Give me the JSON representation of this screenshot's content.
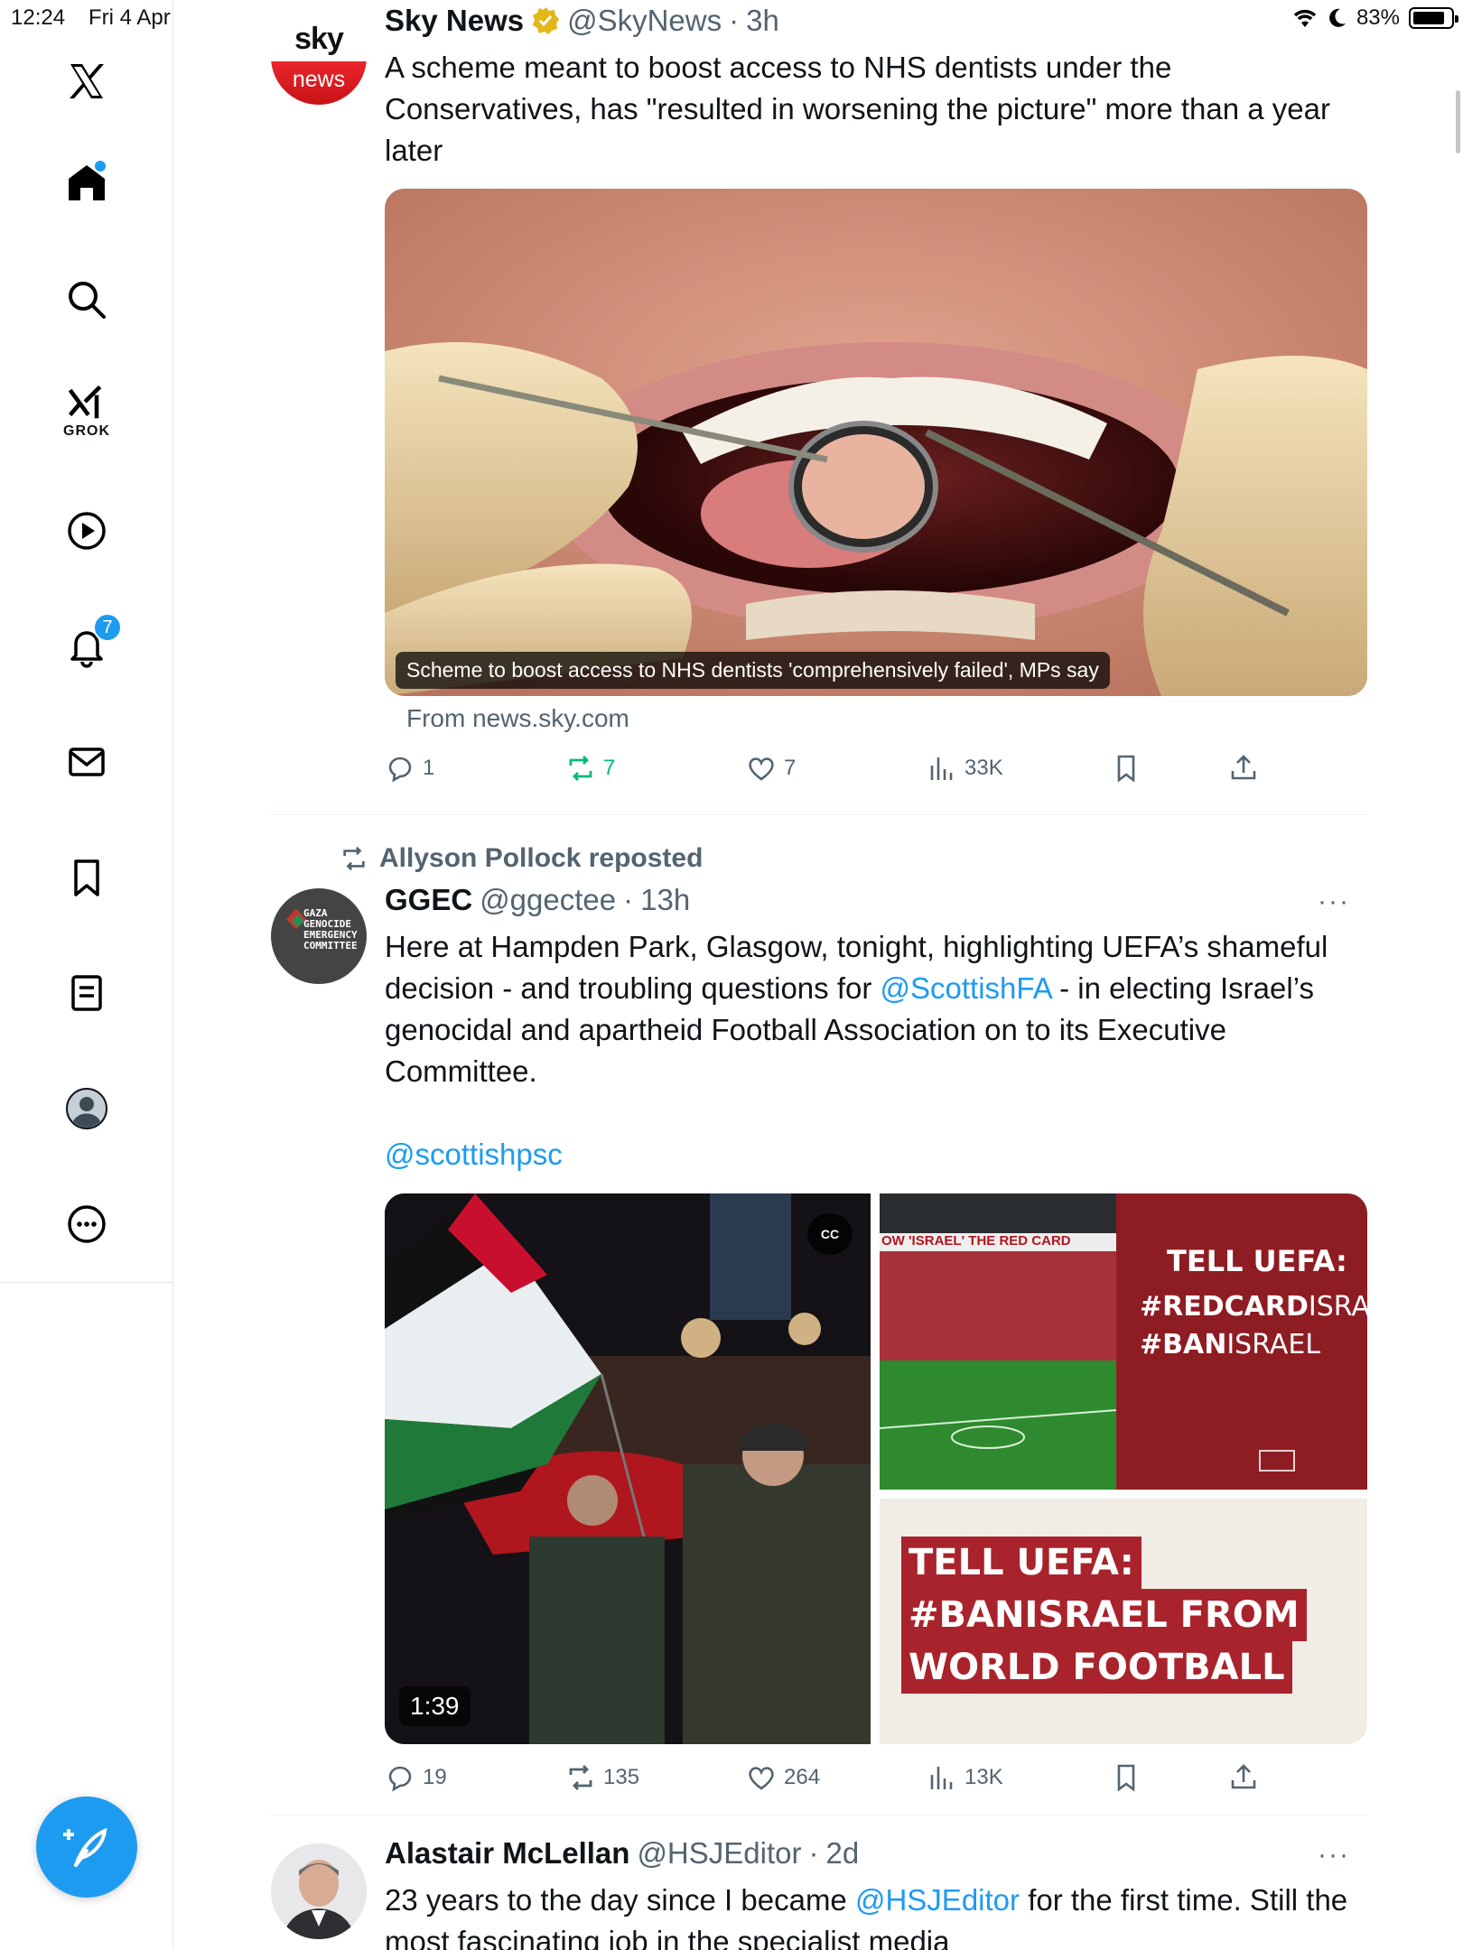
{
  "status": {
    "time": "12:24",
    "date": "Fri 4 Apr",
    "battery": "83%"
  },
  "sidebar": {
    "grok_label": "GROK",
    "notification_count": "7"
  },
  "tweets": [
    {
      "name": "Sky News",
      "handle": "@SkyNews",
      "time": "3h",
      "avatar_text_top": "sky",
      "avatar_text_bottom": "news",
      "text": "A scheme meant to boost access to NHS dentists under the Conservatives, has \"resulted in worsening the picture\" more than a year later",
      "card_caption": "Scheme to boost access to NHS dentists 'comprehensively failed', MPs say",
      "card_source": "From news.sky.com",
      "replies": "1",
      "reposts": "7",
      "likes": "7",
      "views": "33K"
    },
    {
      "repost_by": "Allyson Pollock reposted",
      "name": "GGEC",
      "handle": "@ggectee",
      "time": "13h",
      "avatar_lines": [
        "GAZA",
        "GENOCIDE",
        "EMERGENCY",
        "COMMITTEE"
      ],
      "text_1": "Here at Hampden Park, Glasgow, tonight, highlighting UEFA’s shameful decision - and troubling questions for ",
      "mention_1": "@ScottishFA",
      "text_2": " - in electing Israel’s genocidal and apartheid Football Association on to its Executive Committee.",
      "mention_2": "@scottishpsc",
      "video_duration": "1:39",
      "cc_label": "CC",
      "banner_text": "OW 'ISRAEL' THE RED CARD",
      "panel_title": "TELL UEFA:",
      "panel_tag1_bold": "#REDCARD",
      "panel_tag1_rest": "ISRAEL",
      "panel_tag2_bold": "#BAN",
      "panel_tag2_rest": "ISRAEL",
      "bottom_line1": "TELL UEFA:",
      "bottom_line2": "#BANISRAEL FROM",
      "bottom_line3": "WORLD FOOTBALL",
      "replies": "19",
      "reposts": "135",
      "likes": "264",
      "views": "13K"
    },
    {
      "name": "Alastair McLellan",
      "handle": "@HSJEditor",
      "time": "2d",
      "text_1": "23 years to the day since I became ",
      "mention": "@HSJEditor",
      "text_2": " for the first time. Still the most fascinating job in the specialist media"
    }
  ],
  "colors": {
    "accent": "#1d9bf0",
    "retweet_green": "#00ba7c",
    "muted": "#536471"
  }
}
